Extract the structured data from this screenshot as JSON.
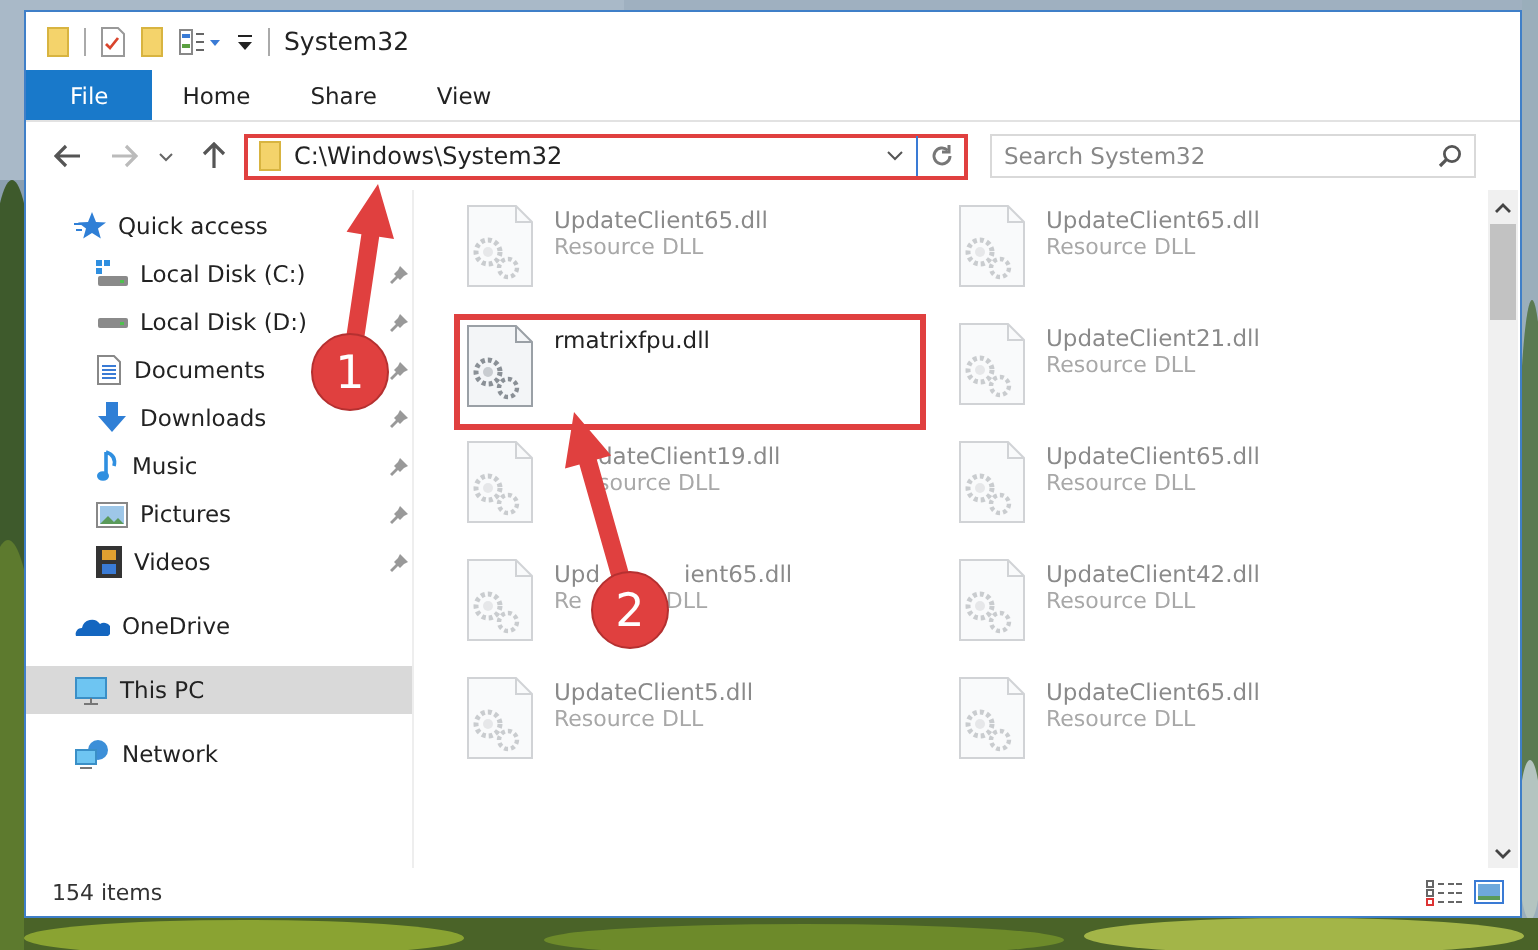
{
  "window": {
    "title": "System32"
  },
  "ribbon_tabs": [
    {
      "label": "File",
      "selected": true
    },
    {
      "label": "Home",
      "selected": false
    },
    {
      "label": "Share",
      "selected": false
    },
    {
      "label": "View",
      "selected": false
    }
  ],
  "address_bar": {
    "path": "C:\\Windows\\System32",
    "highlighted": true
  },
  "search": {
    "placeholder": "Search System32"
  },
  "sidebar": {
    "items": [
      {
        "label": "Quick access",
        "kind": "quick",
        "selected": false,
        "children": [
          {
            "label": "Local Disk (C:)",
            "kind": "windisk",
            "pinned": true,
            "selected": false
          },
          {
            "label": "Local Disk (D:)",
            "kind": "disk",
            "pinned": true,
            "selected": false
          },
          {
            "label": "Documents",
            "kind": "documents",
            "pinned": true,
            "selected": false
          },
          {
            "label": "Downloads",
            "kind": "downloads",
            "pinned": true,
            "selected": false
          },
          {
            "label": "Music",
            "kind": "music",
            "pinned": true,
            "selected": false
          },
          {
            "label": "Pictures",
            "kind": "pictures",
            "pinned": true,
            "selected": false
          },
          {
            "label": "Videos",
            "kind": "videos",
            "pinned": true,
            "selected": false
          }
        ]
      },
      {
        "label": "OneDrive",
        "kind": "onedrive",
        "selected": false
      },
      {
        "label": "This PC",
        "kind": "pc",
        "selected": true
      },
      {
        "label": "Network",
        "kind": "network",
        "selected": false
      }
    ]
  },
  "files": [
    {
      "name": [
        "UpdateClient65.dll"
      ],
      "type": [
        "Resource DLL"
      ],
      "blurred": true,
      "highlighted": false
    },
    {
      "name": [
        "UpdateClient65.dll"
      ],
      "type": [
        "Resource DLL"
      ],
      "blurred": true,
      "highlighted": false
    },
    {
      "name": [
        "rmatrixfpu.dll"
      ],
      "blurred": false,
      "highlighted": true
    },
    {
      "name": [
        "UpdateClient21.dll"
      ],
      "type": [
        "Resource DLL"
      ],
      "blurred": true,
      "highlighted": false
    },
    {
      "name": [
        "dateClient19.dll"
      ],
      "type": [
        "source DLL"
      ],
      "blurred": true,
      "highlighted": false,
      "start_covered": true
    },
    {
      "name": [
        "UpdateClient65.dll"
      ],
      "type": [
        "Resource DLL"
      ],
      "blurred": true,
      "highlighted": false
    },
    {
      "name": [
        "Upd",
        "ient65.dll"
      ],
      "type": [
        "Re",
        "DLL"
      ],
      "blurred": true,
      "highlighted": false
    },
    {
      "name": [
        "UpdateClient42.dll"
      ],
      "type": [
        "Resource DLL"
      ],
      "blurred": true,
      "highlighted": false
    },
    {
      "name": [
        "UpdateClient5.dll"
      ],
      "type": [
        "Resource DLL"
      ],
      "blurred": true,
      "highlighted": false
    },
    {
      "name": [
        "UpdateClient65.dll"
      ],
      "type": [
        "Resource DLL"
      ],
      "blurred": true,
      "highlighted": false
    }
  ],
  "status_bar": {
    "item_count": "154 items"
  },
  "annotations": [
    {
      "label": "1"
    },
    {
      "label": "2"
    }
  ]
}
